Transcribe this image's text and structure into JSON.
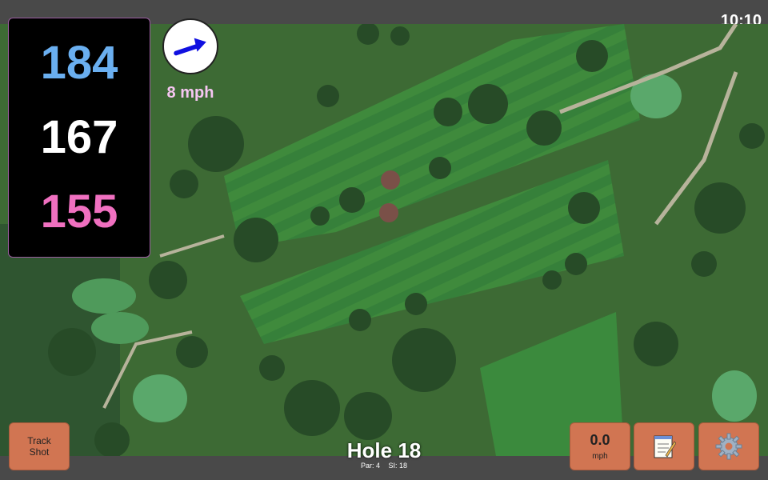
{
  "status_bar": {
    "time": "10:10"
  },
  "distances": {
    "back": "184",
    "middle": "167",
    "front": "155"
  },
  "wind": {
    "speed_label": "8 mph",
    "direction_icon": "arrow-up-right"
  },
  "hole": {
    "title": "Hole 18",
    "par_label": "Par: 4",
    "si_label": "SI: 18"
  },
  "buttons": {
    "track_shot_label": "Track\nShot",
    "speed_value": "0.0",
    "speed_unit": "mph",
    "notes_icon": "notepad-icon",
    "settings_icon": "gear-icon"
  },
  "colors": {
    "back_distance": "#6aaff0",
    "middle_distance": "#ffffff",
    "front_distance": "#f070c0",
    "button_bg": "#d17552",
    "wind_text": "#f6c6f2"
  }
}
